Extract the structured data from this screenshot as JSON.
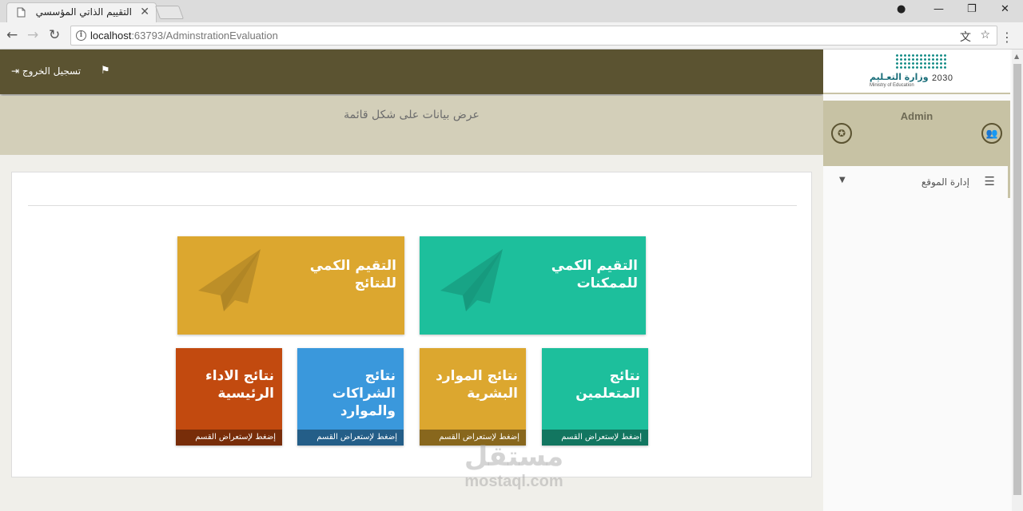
{
  "browser": {
    "tab_title": "التقييم الذاتي المؤسسي",
    "url_host": "localhost",
    "url_path": ":63793/AdminstrationEvaluation"
  },
  "header": {
    "logout_label": "تسجيل الخروج",
    "page_subtitle": "عرض بيانات على شكل قائمة"
  },
  "sidebar": {
    "logo_ar": "وزارة التعـليم",
    "logo_en": "Ministry of Education",
    "logo_year": "2030",
    "user_name": "Admin",
    "menu_item": "إدارة الموقع"
  },
  "tiles_big": [
    {
      "title": "التقيم الكمي\nللنتائج",
      "color": "#dca72f",
      "icon": "paper-plane-icon"
    },
    {
      "title": "التقيم الكمي\nللممكنات",
      "color": "#1dbf9c",
      "icon": "paper-plane-icon"
    }
  ],
  "tiles_small": [
    {
      "title": "نتائج الاداء\nالرئيسية",
      "footer": "إضغط لإستعراض القسم",
      "color": "#c24a0f"
    },
    {
      "title": "نتائج\nالشراكات\nوالموارد",
      "footer": "إضغط لإستعراض القسم",
      "color": "#3a98dc"
    },
    {
      "title": "نتائج الموارد\nالبشرية",
      "footer": "إضغط لإستعراض القسم",
      "color": "#dca72f"
    },
    {
      "title": "نتائج\nالمتعلمين",
      "footer": "إضغط لإستعراض القسم",
      "color": "#1dbf9c"
    }
  ],
  "watermark": {
    "ar": "مستقل",
    "en": "mostaql.com"
  }
}
